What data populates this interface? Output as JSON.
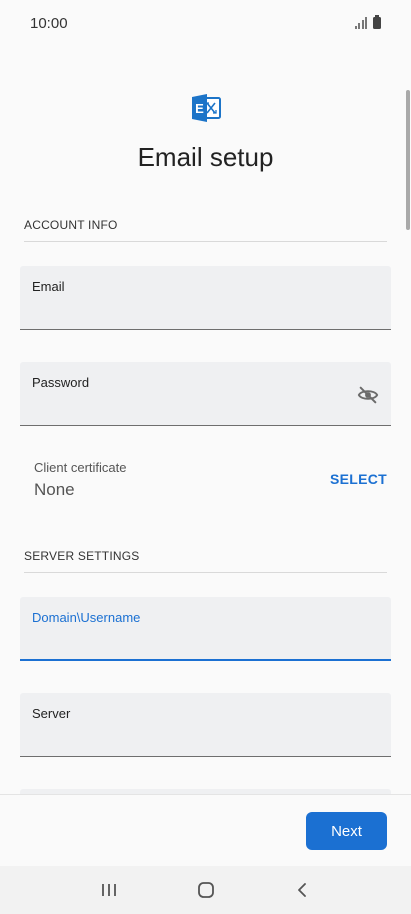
{
  "status_bar": {
    "time": "10:00"
  },
  "header": {
    "title": "Email setup"
  },
  "sections": {
    "account_info": "ACCOUNT INFO",
    "server_settings": "SERVER SETTINGS"
  },
  "fields": {
    "email": {
      "label": "Email",
      "value": ""
    },
    "password": {
      "label": "Password",
      "value": ""
    },
    "domain_username": {
      "label": "Domain\\Username",
      "value": ""
    },
    "server": {
      "label": "Server",
      "value": ""
    }
  },
  "client_certificate": {
    "label": "Client certificate",
    "value": "None",
    "action_label": "SELECT"
  },
  "footer": {
    "next_label": "Next"
  },
  "nav": {
    "icons": [
      "recent-apps-icon",
      "home-icon",
      "back-icon"
    ]
  },
  "colors": {
    "accent": "#1b70d2",
    "exchange_brand": "#1c74c8",
    "field_bg": "#eff0f2"
  }
}
